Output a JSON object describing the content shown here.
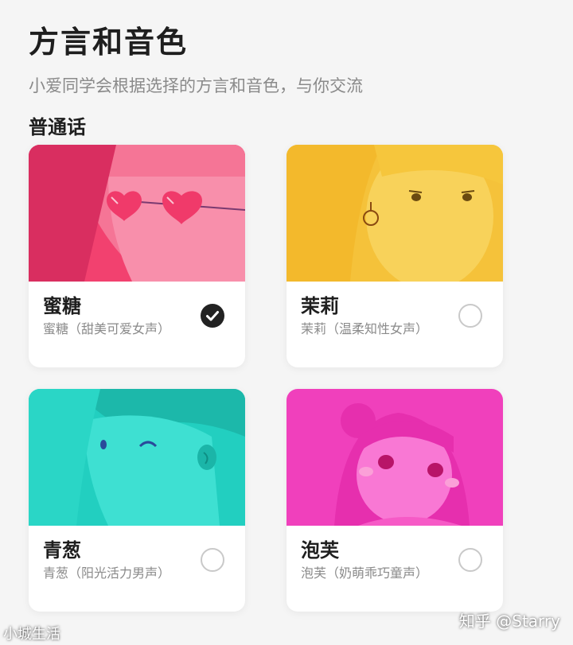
{
  "header": {
    "title": "方言和音色",
    "subtitle": "小爱同学会根据选择的方言和音色，与你交流"
  },
  "section": {
    "label": "普通话"
  },
  "voices": [
    {
      "name": "蜜糖",
      "desc": "蜜糖（甜美可爱女声）",
      "selected": true,
      "color": "#f23f74"
    },
    {
      "name": "茉莉",
      "desc": "茉莉（温柔知性女声）",
      "selected": false,
      "color": "#f5c63a"
    },
    {
      "name": "青葱",
      "desc": "青葱（阳光活力男声）",
      "selected": false,
      "color": "#22cfc0"
    },
    {
      "name": "泡芙",
      "desc": "泡芙（奶萌乖巧童声）",
      "selected": false,
      "color": "#f03fbc"
    }
  ],
  "icons": {
    "selected": "check-icon",
    "unselected": "radio-empty-icon"
  },
  "watermarks": {
    "left": "小城生活",
    "right": "知乎 @Starry"
  }
}
